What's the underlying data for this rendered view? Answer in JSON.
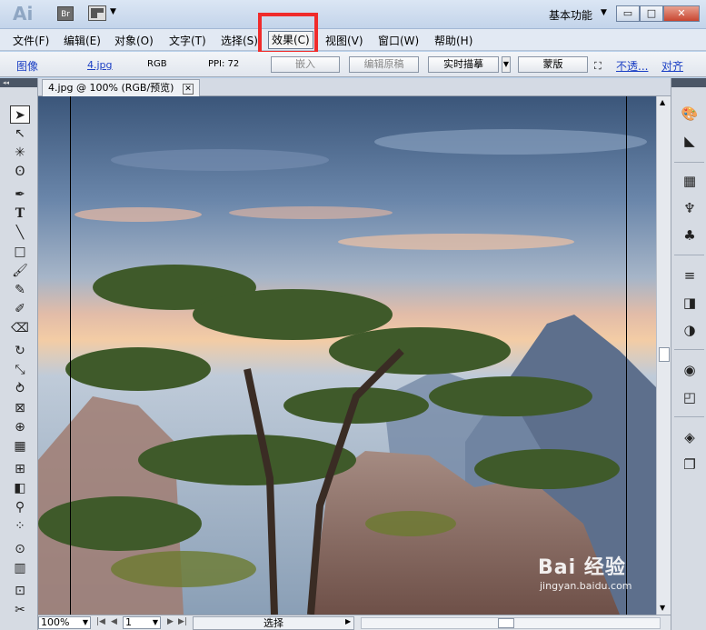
{
  "titlebar": {
    "app_logo": "Ai",
    "bridge_label": "Br",
    "workspace_label": "基本功能",
    "minimize": "▭",
    "maximize": "□",
    "close": "✕"
  },
  "menu": {
    "items": [
      "文件(F)",
      "编辑(E)",
      "对象(O)",
      "文字(T)",
      "选择(S)",
      "效果(C)",
      "视图(V)",
      "窗口(W)",
      "帮助(H)"
    ],
    "active_index": 5
  },
  "controlbar": {
    "type_label": "图像",
    "filename": "4.jpg",
    "color_mode": "RGB",
    "ppi": "PPI: 72",
    "embed_btn": "嵌入",
    "edit_original_btn": "编辑原稿",
    "live_trace_btn": "实时描摹",
    "mask_btn": "蒙版",
    "opacity_link": "不透...",
    "align_link": "对齐"
  },
  "document": {
    "tab_title": "4.jpg @ 100% (RGB/预览)",
    "tab_close": "✕"
  },
  "statusbar": {
    "zoom": "100%",
    "page": "1",
    "status": "选择"
  },
  "watermark": {
    "main": "Bai 经验",
    "sub": "jingyan.baidu.com"
  },
  "colors": {
    "highlight": "#f02b2b",
    "link": "#1b3fc4"
  }
}
